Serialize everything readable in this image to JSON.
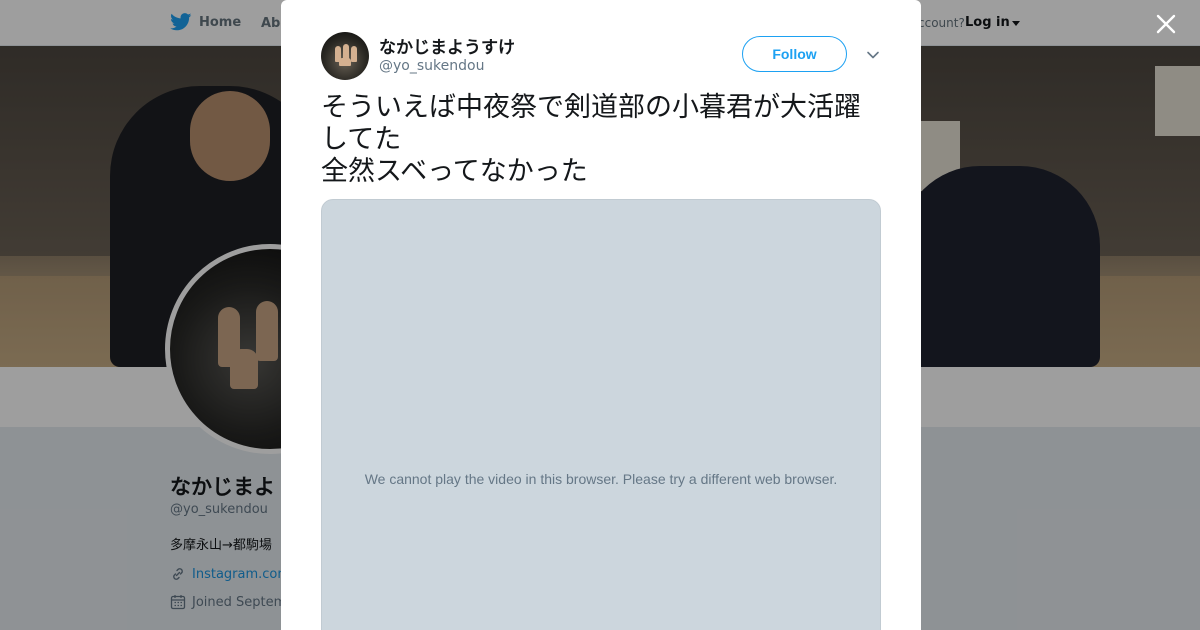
{
  "topbar": {
    "home_label": "Home",
    "about_label": "Abo",
    "account_label": "ccount?",
    "login_label": "Log in"
  },
  "profile": {
    "name": "なかじまよ",
    "handle": "@yo_sukendou",
    "bio": "多摩永山→都駒場",
    "link": "Instagram.com",
    "joined": "Joined Septem"
  },
  "tweet": {
    "author_name": "なかじまようすけ",
    "author_handle": "@yo_sukendou",
    "follow_label": "Follow",
    "text": "そういえば中夜祭で剣道部の小暮君が大活躍してた\n全然スベってなかった",
    "video_message": "We cannot play the video in this browser. Please try a different web browser."
  },
  "colors": {
    "accent": "#1da1f2",
    "link": "#1b95e0",
    "muted": "#657786",
    "video_bg": "#ccd6dd"
  },
  "icons": {
    "brand": "twitter-bird-icon",
    "close": "close-icon",
    "more": "chevron-down-icon",
    "link": "link-icon",
    "calendar": "calendar-icon"
  }
}
